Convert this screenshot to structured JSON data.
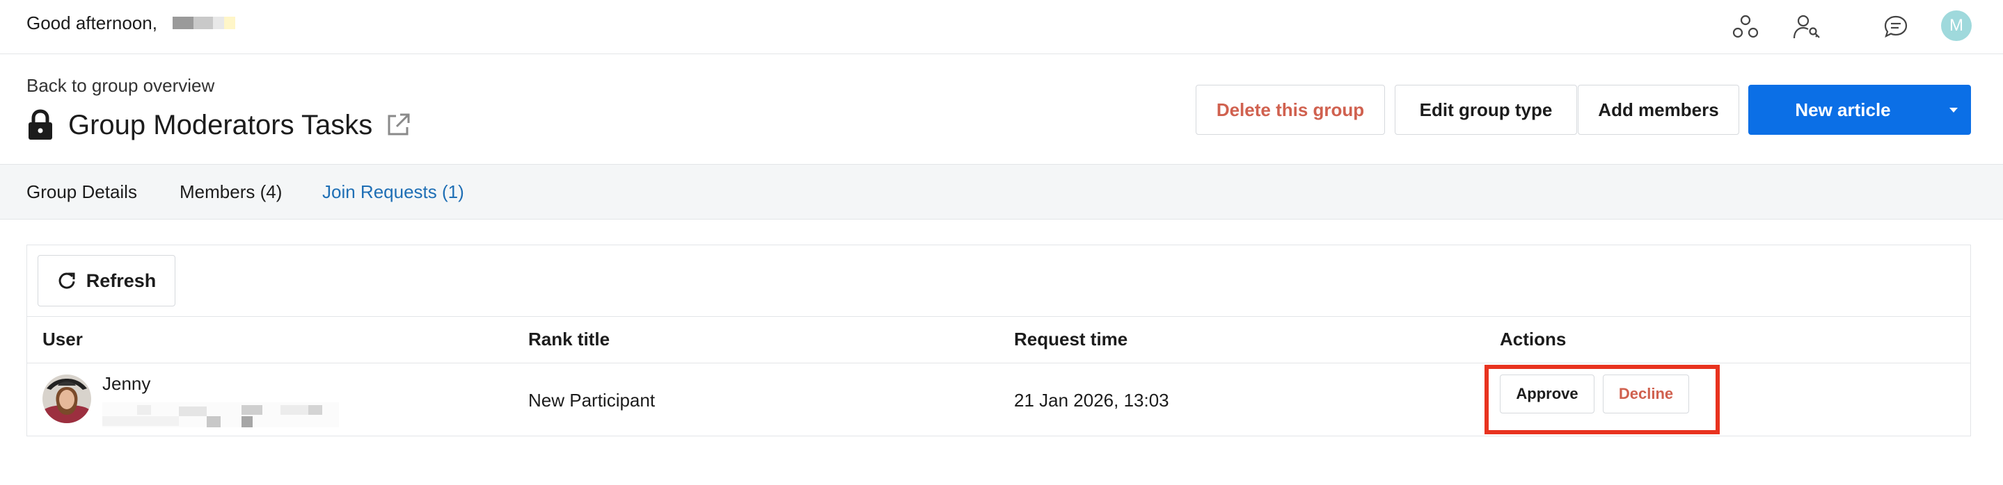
{
  "topbar": {
    "greeting": "Good afternoon,",
    "avatar_letter": "M",
    "icons": [
      "groups-icon",
      "user-key-icon",
      "chat-icon"
    ]
  },
  "header": {
    "back_link": "Back to group overview",
    "title": "Group Moderators Tasks",
    "buttons": {
      "delete": "Delete this group",
      "edit_type": "Edit group type",
      "add_members": "Add members",
      "new_article": "New article"
    }
  },
  "tabs": [
    {
      "label": "Group Details"
    },
    {
      "label": "Members (4)"
    },
    {
      "label": "Join Requests (1)",
      "active": true
    }
  ],
  "panel": {
    "refresh_label": "Refresh",
    "columns": [
      "User",
      "Rank title",
      "Request time",
      "Actions"
    ],
    "rows": [
      {
        "user": "Jenny",
        "rank_title": "New Participant",
        "request_time": "21 Jan 2026, 13:03",
        "approve_label": "Approve",
        "decline_label": "Decline"
      }
    ]
  },
  "colors": {
    "primary": "#0b6fe6",
    "danger": "#d0614f",
    "active_tab": "#1f6fb5",
    "highlight": "#e8331f"
  }
}
